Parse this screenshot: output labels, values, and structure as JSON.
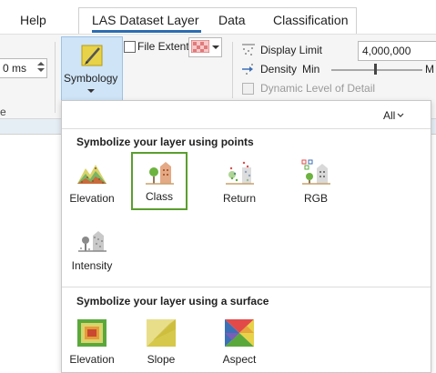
{
  "tabs": {
    "help": "Help",
    "las_dataset_layer": "LAS Dataset Layer",
    "data": "Data",
    "classification": "Classification"
  },
  "ribbon": {
    "left_field_value": "0",
    "left_field_unit": "ms",
    "left_group_fragment": "e",
    "symbology_label": "Symbology",
    "file_extent_label": "File Extent",
    "display_limit_label": "Display Limit",
    "display_limit_value": "4,000,000",
    "density_label": "Density",
    "density_min": "Min",
    "density_max_fragment": "M",
    "density_level": 0.48,
    "dynamic_lod_label": "Dynamic Level of Detail"
  },
  "gallery": {
    "filter_label": "All",
    "points_section_title": "Symbolize your layer using points",
    "points_items": [
      {
        "label": "Elevation",
        "icon": "elevation-points-icon",
        "selected": false
      },
      {
        "label": "Class",
        "icon": "class-icon",
        "selected": true
      },
      {
        "label": "Return",
        "icon": "return-icon",
        "selected": false
      },
      {
        "label": "RGB",
        "icon": "rgb-icon",
        "selected": false
      },
      {
        "label": "Intensity",
        "icon": "intensity-icon",
        "selected": false
      }
    ],
    "surface_section_title": "Symbolize your layer using a surface",
    "surface_items": [
      {
        "label": "Elevation",
        "icon": "elevation-surface-icon"
      },
      {
        "label": "Slope",
        "icon": "slope-icon"
      },
      {
        "label": "Aspect",
        "icon": "aspect-icon"
      }
    ]
  },
  "colors": {
    "accent_blue": "#2b6cb0",
    "selected_green": "#5a9e2f",
    "symbology_pressed_bg": "#cfe4f7"
  }
}
